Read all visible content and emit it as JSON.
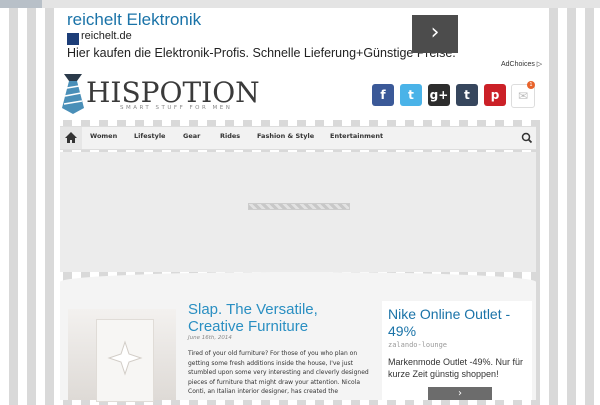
{
  "ad_banner": {
    "title": "reichelt Elektronik",
    "domain": "reichelt.de",
    "description": "Hier kaufen die Elektronik-Profis. Schnelle Lieferung+Günstige Preise.",
    "arrow": "›",
    "adchoices": "AdChoices ▷"
  },
  "header": {
    "logo_text": "HISPOTION",
    "tagline": "SMART STUFF FOR MEN",
    "social": [
      {
        "icon": "facebook-icon",
        "glyph": "f",
        "color": "#3b5998"
      },
      {
        "icon": "twitter-icon",
        "glyph": "t",
        "color": "#4ab3e8"
      },
      {
        "icon": "google-plus-icon",
        "glyph": "g+",
        "color": "#2d2d2d"
      },
      {
        "icon": "tumblr-icon",
        "glyph": "t",
        "color": "#36465d"
      },
      {
        "icon": "pinterest-icon",
        "glyph": "p",
        "color": "#cb2027"
      },
      {
        "icon": "mail-icon",
        "glyph": "✉",
        "color": "#ffffff"
      }
    ],
    "mail_badge": "1"
  },
  "nav": {
    "items": [
      "Women",
      "Lifestyle",
      "Gear",
      "Rides",
      "Fashion & Style",
      "Entertainment"
    ]
  },
  "article": {
    "title": "Slap. The Versatile, Creative Furniture",
    "date": "June 16th, 2014",
    "body": "Tired of your old furniture? For those of you who plan on getting some fresh additions inside the house, I've just stumbled upon some very interesting and cleverly designed pieces of furniture that might draw your attention. Nicola Conti, an Italian interior designer, has created the"
  },
  "side_ad": {
    "title": "Nike Online Outlet - 49%",
    "domain": "zalando-lounge",
    "description": "Markenmode Outlet -49%. Nur für kurze Zeit günstig shoppen!",
    "arrow": "›"
  }
}
